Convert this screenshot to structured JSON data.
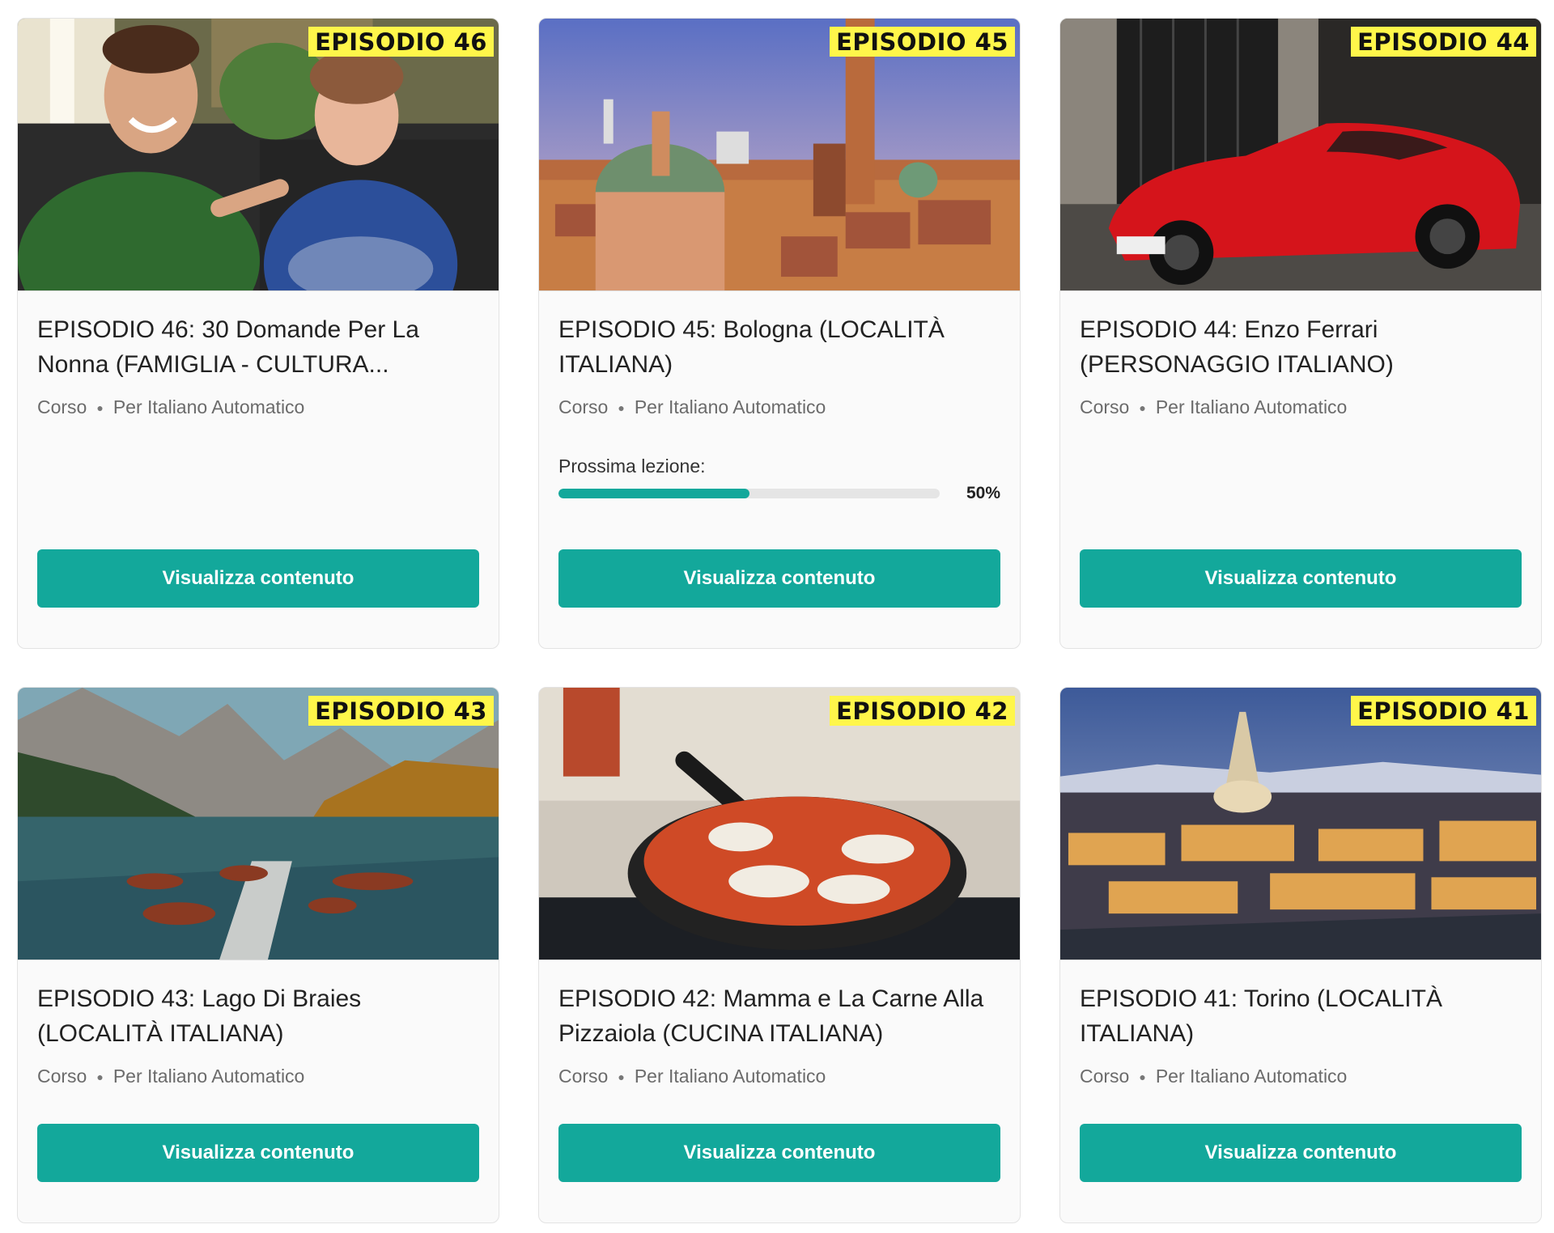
{
  "cards": [
    {
      "badge": "EPISODIO 46",
      "title": "EPISODIO 46: 30 Domande Per La Nonna (FAMIGLIA - CULTURA...",
      "type": "Corso",
      "author": "Per Italiano Automatico",
      "button": "Visualizza contenuto",
      "image": "two-people-on-sofa"
    },
    {
      "badge": "EPISODIO 45",
      "title": "EPISODIO 45: Bologna (LOCALITÀ ITALIANA)",
      "type": "Corso",
      "author": "Per Italiano Automatico",
      "progress_label": "Prossima lezione:",
      "progress_value": 0.5,
      "progress_text": "50%",
      "button": "Visualizza contenuto",
      "image": "bologna-cityscape"
    },
    {
      "badge": "EPISODIO 44",
      "title": "EPISODIO 44: Enzo Ferrari (PERSONAGGIO ITALIANO)",
      "type": "Corso",
      "author": "Per Italiano Automatico",
      "button": "Visualizza contenuto",
      "image": "red-sports-car"
    },
    {
      "badge": "EPISODIO 43",
      "title": "EPISODIO 43: Lago Di Braies (LOCALITÀ ITALIANA)",
      "type": "Corso",
      "author": "Per Italiano Automatico",
      "button": "Visualizza contenuto",
      "image": "mountain-lake-boats"
    },
    {
      "badge": "EPISODIO 42",
      "title": "EPISODIO 42: Mamma e La Carne Alla Pizzaiola (CUCINA ITALIANA)",
      "type": "Corso",
      "author": "Per Italiano Automatico",
      "button": "Visualizza contenuto",
      "image": "pan-tomato-sauce"
    },
    {
      "badge": "EPISODIO 41",
      "title": "EPISODIO 41: Torino (LOCALITÀ ITALIANA)",
      "type": "Corso",
      "author": "Per Italiano Automatico",
      "button": "Visualizza contenuto",
      "image": "turin-night-skyline"
    }
  ],
  "colors": {
    "accent": "#13a89b",
    "badge": "#fff64a",
    "card_bg": "#fafafa"
  }
}
